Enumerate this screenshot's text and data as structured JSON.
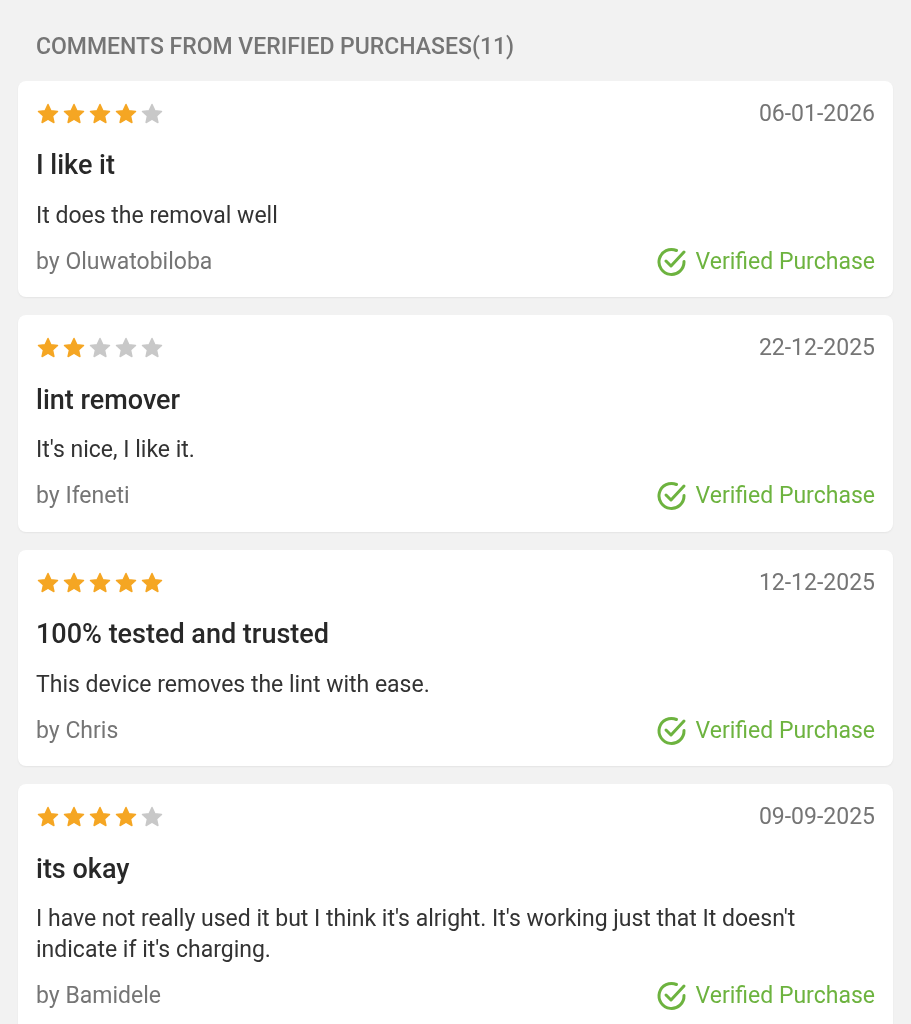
{
  "heading": "COMMENTS FROM VERIFIED PURCHASES(11)",
  "reviews": [
    {
      "stars": 4,
      "date": "06-01-2026",
      "title": "I like it",
      "body": "It does the removal well",
      "author": "by Oluwatobiloba",
      "verified": true,
      "badge": "Verified Purchase"
    },
    {
      "stars": 2,
      "date": "22-12-2025",
      "title": "lint remover",
      "body": "It's nice, I like it.",
      "author": "by Ifeneti",
      "verified": true,
      "badge": "Verified Purchase"
    },
    {
      "stars": 5,
      "date": "12-12-2025",
      "title": "100% tested and trusted",
      "body": "This device removes the lint with ease.",
      "author": "by Chris",
      "verified": true,
      "badge": "Verified Purchase"
    },
    {
      "stars": 4,
      "date": "09-09-2025",
      "title": "its okay",
      "body": "I have not really used it but I think it's alright. It's working just that It doesn't indicate if it's charging.",
      "author": "by Bamidele",
      "verified": true,
      "badge": "Verified Purchase"
    }
  ]
}
